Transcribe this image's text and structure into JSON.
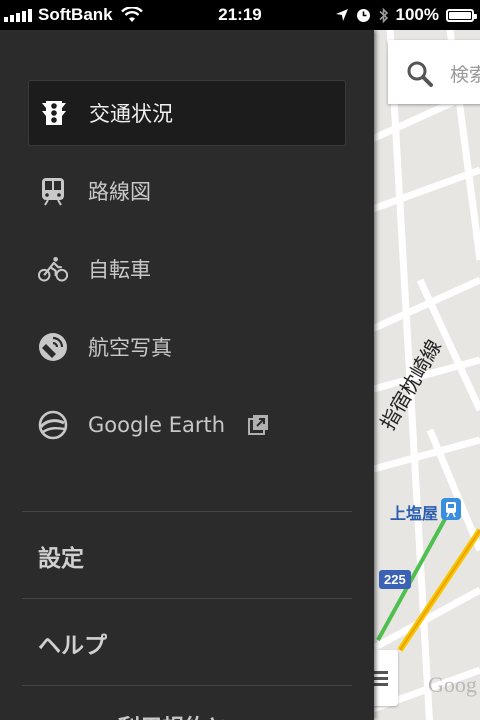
{
  "status_bar": {
    "carrier": "SoftBank",
    "time": "21:19",
    "battery": "100%",
    "battery_level": 1.0
  },
  "map": {
    "search_placeholder": "検索",
    "station_label": "上塩屋",
    "line_label": "指宿枕崎線",
    "route_badge": "225",
    "watermark": "Goog"
  },
  "drawer": {
    "layers": [
      {
        "label": "交通状況",
        "icon": "traffic-light-icon",
        "active": true
      },
      {
        "label": "路線図",
        "icon": "train-icon",
        "active": false
      },
      {
        "label": "自転車",
        "icon": "bicycle-icon",
        "active": false
      },
      {
        "label": "航空写真",
        "icon": "satellite-icon",
        "active": false
      },
      {
        "label": "Google Earth",
        "icon": "google-earth-icon",
        "active": false,
        "external": true
      }
    ],
    "settings_label": "設定",
    "help_label": "ヘルプ",
    "cutoff_label": "利用規約と"
  }
}
